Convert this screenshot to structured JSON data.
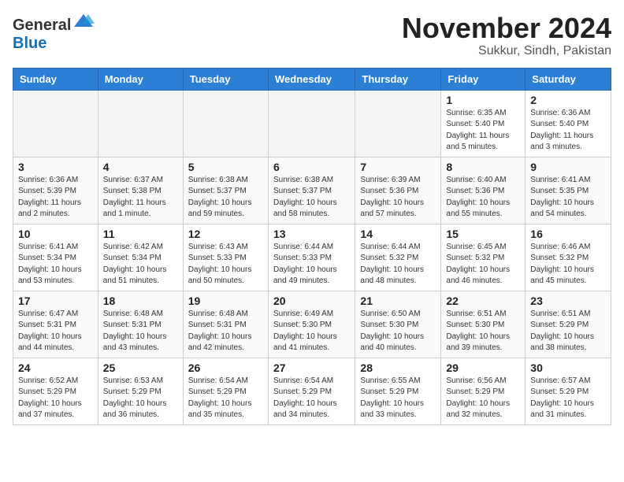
{
  "header": {
    "logo_general": "General",
    "logo_blue": "Blue",
    "title": "November 2024",
    "location": "Sukkur, Sindh, Pakistan"
  },
  "weekdays": [
    "Sunday",
    "Monday",
    "Tuesday",
    "Wednesday",
    "Thursday",
    "Friday",
    "Saturday"
  ],
  "weeks": [
    [
      {
        "day": "",
        "info": ""
      },
      {
        "day": "",
        "info": ""
      },
      {
        "day": "",
        "info": ""
      },
      {
        "day": "",
        "info": ""
      },
      {
        "day": "",
        "info": ""
      },
      {
        "day": "1",
        "info": "Sunrise: 6:35 AM\nSunset: 5:40 PM\nDaylight: 11 hours\nand 5 minutes."
      },
      {
        "day": "2",
        "info": "Sunrise: 6:36 AM\nSunset: 5:40 PM\nDaylight: 11 hours\nand 3 minutes."
      }
    ],
    [
      {
        "day": "3",
        "info": "Sunrise: 6:36 AM\nSunset: 5:39 PM\nDaylight: 11 hours\nand 2 minutes."
      },
      {
        "day": "4",
        "info": "Sunrise: 6:37 AM\nSunset: 5:38 PM\nDaylight: 11 hours\nand 1 minute."
      },
      {
        "day": "5",
        "info": "Sunrise: 6:38 AM\nSunset: 5:37 PM\nDaylight: 10 hours\nand 59 minutes."
      },
      {
        "day": "6",
        "info": "Sunrise: 6:38 AM\nSunset: 5:37 PM\nDaylight: 10 hours\nand 58 minutes."
      },
      {
        "day": "7",
        "info": "Sunrise: 6:39 AM\nSunset: 5:36 PM\nDaylight: 10 hours\nand 57 minutes."
      },
      {
        "day": "8",
        "info": "Sunrise: 6:40 AM\nSunset: 5:36 PM\nDaylight: 10 hours\nand 55 minutes."
      },
      {
        "day": "9",
        "info": "Sunrise: 6:41 AM\nSunset: 5:35 PM\nDaylight: 10 hours\nand 54 minutes."
      }
    ],
    [
      {
        "day": "10",
        "info": "Sunrise: 6:41 AM\nSunset: 5:34 PM\nDaylight: 10 hours\nand 53 minutes."
      },
      {
        "day": "11",
        "info": "Sunrise: 6:42 AM\nSunset: 5:34 PM\nDaylight: 10 hours\nand 51 minutes."
      },
      {
        "day": "12",
        "info": "Sunrise: 6:43 AM\nSunset: 5:33 PM\nDaylight: 10 hours\nand 50 minutes."
      },
      {
        "day": "13",
        "info": "Sunrise: 6:44 AM\nSunset: 5:33 PM\nDaylight: 10 hours\nand 49 minutes."
      },
      {
        "day": "14",
        "info": "Sunrise: 6:44 AM\nSunset: 5:32 PM\nDaylight: 10 hours\nand 48 minutes."
      },
      {
        "day": "15",
        "info": "Sunrise: 6:45 AM\nSunset: 5:32 PM\nDaylight: 10 hours\nand 46 minutes."
      },
      {
        "day": "16",
        "info": "Sunrise: 6:46 AM\nSunset: 5:32 PM\nDaylight: 10 hours\nand 45 minutes."
      }
    ],
    [
      {
        "day": "17",
        "info": "Sunrise: 6:47 AM\nSunset: 5:31 PM\nDaylight: 10 hours\nand 44 minutes."
      },
      {
        "day": "18",
        "info": "Sunrise: 6:48 AM\nSunset: 5:31 PM\nDaylight: 10 hours\nand 43 minutes."
      },
      {
        "day": "19",
        "info": "Sunrise: 6:48 AM\nSunset: 5:31 PM\nDaylight: 10 hours\nand 42 minutes."
      },
      {
        "day": "20",
        "info": "Sunrise: 6:49 AM\nSunset: 5:30 PM\nDaylight: 10 hours\nand 41 minutes."
      },
      {
        "day": "21",
        "info": "Sunrise: 6:50 AM\nSunset: 5:30 PM\nDaylight: 10 hours\nand 40 minutes."
      },
      {
        "day": "22",
        "info": "Sunrise: 6:51 AM\nSunset: 5:30 PM\nDaylight: 10 hours\nand 39 minutes."
      },
      {
        "day": "23",
        "info": "Sunrise: 6:51 AM\nSunset: 5:29 PM\nDaylight: 10 hours\nand 38 minutes."
      }
    ],
    [
      {
        "day": "24",
        "info": "Sunrise: 6:52 AM\nSunset: 5:29 PM\nDaylight: 10 hours\nand 37 minutes."
      },
      {
        "day": "25",
        "info": "Sunrise: 6:53 AM\nSunset: 5:29 PM\nDaylight: 10 hours\nand 36 minutes."
      },
      {
        "day": "26",
        "info": "Sunrise: 6:54 AM\nSunset: 5:29 PM\nDaylight: 10 hours\nand 35 minutes."
      },
      {
        "day": "27",
        "info": "Sunrise: 6:54 AM\nSunset: 5:29 PM\nDaylight: 10 hours\nand 34 minutes."
      },
      {
        "day": "28",
        "info": "Sunrise: 6:55 AM\nSunset: 5:29 PM\nDaylight: 10 hours\nand 33 minutes."
      },
      {
        "day": "29",
        "info": "Sunrise: 6:56 AM\nSunset: 5:29 PM\nDaylight: 10 hours\nand 32 minutes."
      },
      {
        "day": "30",
        "info": "Sunrise: 6:57 AM\nSunset: 5:29 PM\nDaylight: 10 hours\nand 31 minutes."
      }
    ]
  ]
}
